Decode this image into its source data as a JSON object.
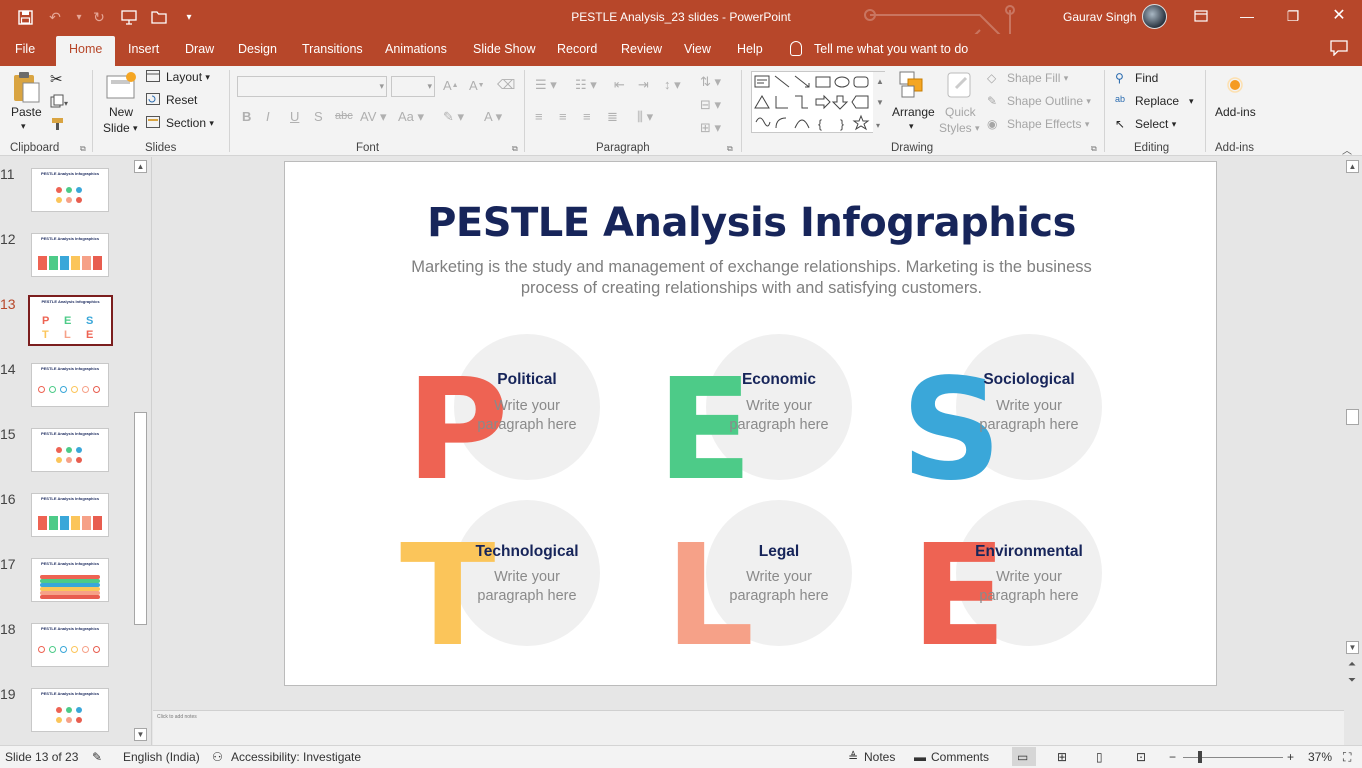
{
  "app": {
    "doc_title": "PESTLE Analysis_23 slides  -  PowerPoint",
    "user_name": "Gaurav Singh"
  },
  "tabs": [
    "File",
    "Home",
    "Insert",
    "Draw",
    "Design",
    "Transitions",
    "Animations",
    "Slide Show",
    "Record",
    "Review",
    "View",
    "Help"
  ],
  "active_tab": "Home",
  "tell_me": "Tell me what you want to do",
  "ribbon": {
    "clipboard": {
      "label": "Clipboard",
      "paste": "Paste"
    },
    "slides": {
      "label": "Slides",
      "new_slide_1": "New",
      "new_slide_2": "Slide",
      "layout": "Layout",
      "reset": "Reset",
      "section": "Section"
    },
    "font": {
      "label": "Font"
    },
    "paragraph": {
      "label": "Paragraph"
    },
    "drawing": {
      "label": "Drawing",
      "arrange": "Arrange",
      "quick_styles_1": "Quick",
      "quick_styles_2": "Styles",
      "shape_fill": "Shape Fill",
      "shape_outline": "Shape Outline",
      "shape_effects": "Shape Effects"
    },
    "editing": {
      "label": "Editing",
      "find": "Find",
      "replace": "Replace",
      "select": "Select"
    },
    "addins": {
      "label": "Add-ins",
      "button": "Add-ins"
    }
  },
  "thumbnails": [
    {
      "num": "11",
      "title": "PESTLE Analysis Infographics"
    },
    {
      "num": "12",
      "title": "PESTLE Analysis Infographics"
    },
    {
      "num": "13",
      "title": "PESTLE Analysis Infographics"
    },
    {
      "num": "14",
      "title": "PESTLE Analysis Infographics"
    },
    {
      "num": "15",
      "title": "PESTLE Analysis Infographics"
    },
    {
      "num": "16",
      "title": "PESTLE Analysis Infographics"
    },
    {
      "num": "17",
      "title": "PESTLE Analysis Infographics"
    },
    {
      "num": "18",
      "title": "PESTLE Analysis Infographics"
    },
    {
      "num": "19",
      "title": "PESTLE Analysis Infographics"
    }
  ],
  "active_thumb": "13",
  "slide": {
    "title": "PESTLE Analysis Infographics",
    "subtitle": "Marketing is the study and management of exchange relationships. Marketing is the business process of creating relationships with and satisfying customers.",
    "items": [
      {
        "letter": "P",
        "title": "Political",
        "body": "Write your paragraph here",
        "color": "#ee6353"
      },
      {
        "letter": "E",
        "title": "Economic",
        "body": "Write your paragraph here",
        "color": "#4dcb88"
      },
      {
        "letter": "S",
        "title": "Sociological",
        "body": "Write your paragraph here",
        "color": "#3aa7d9"
      },
      {
        "letter": "T",
        "title": "Technological",
        "body": "Write your paragraph here",
        "color": "#fbc55a"
      },
      {
        "letter": "L",
        "title": "Legal",
        "body": "Write your paragraph here",
        "color": "#f6a188"
      },
      {
        "letter": "E",
        "title": "Environmental",
        "body": "Write your paragraph here",
        "color": "#ee6353"
      }
    ]
  },
  "notes_placeholder": "Click to add notes",
  "status": {
    "slide_of": "Slide 13 of 23",
    "language": "English (India)",
    "accessibility": "Accessibility: Investigate",
    "notes": "Notes",
    "comments": "Comments",
    "zoom": "37%"
  }
}
